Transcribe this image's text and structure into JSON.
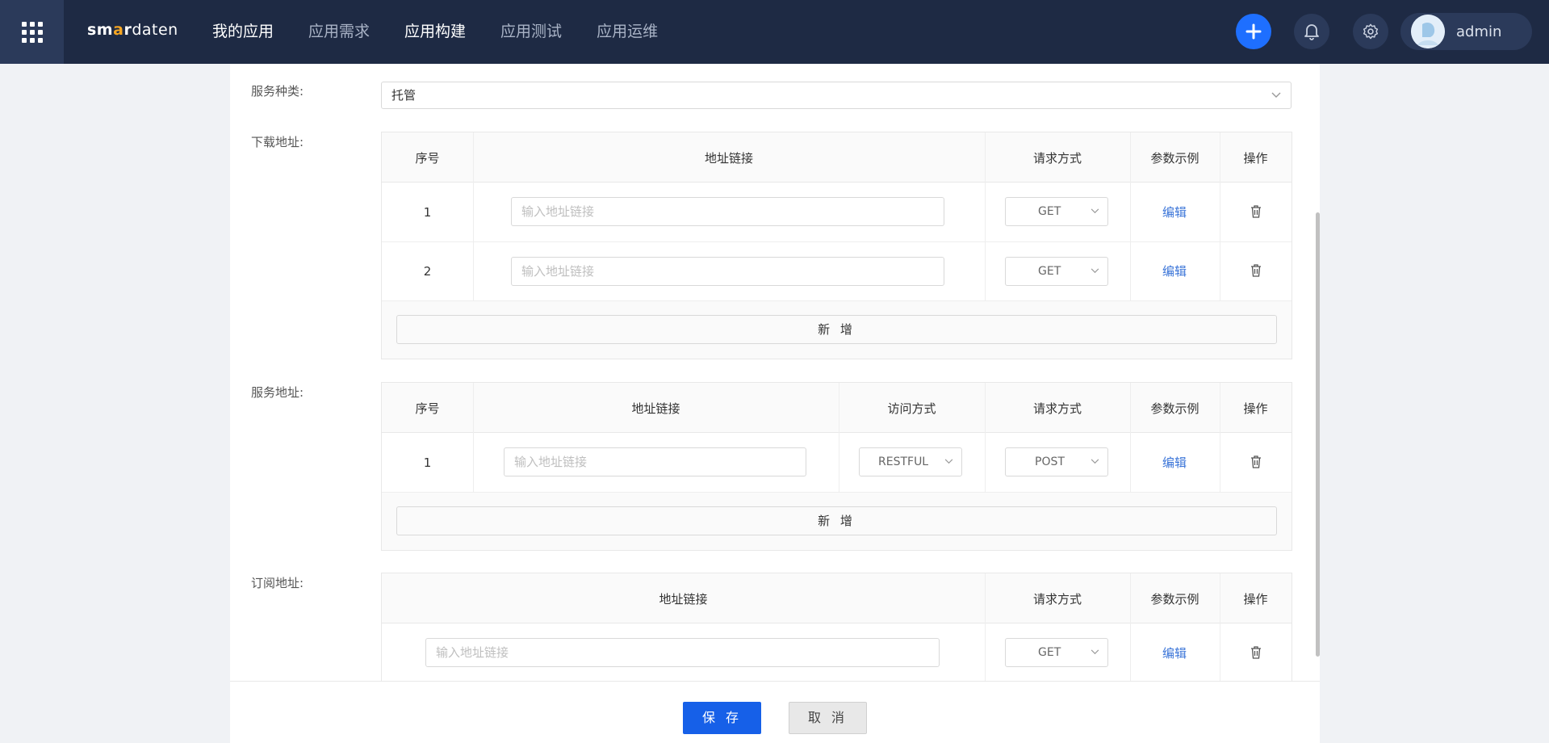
{
  "topbar": {
    "logo": {
      "p1": "sm",
      "p2": "a",
      "p3": "r",
      "p4": "daten"
    },
    "nav": [
      "我的应用",
      "应用需求",
      "应用构建",
      "应用测试",
      "应用运维"
    ],
    "user_name": "admin",
    "icons": {
      "menu": "app-grid-icon",
      "add": "plus-icon",
      "notify": "bell-icon",
      "settings": "gear-icon"
    }
  },
  "form": {
    "service_type_label": "服务种类:",
    "service_type_value": "托管",
    "download": {
      "label": "下载地址:",
      "headers": [
        "序号",
        "地址链接",
        "请求方式",
        "参数示例",
        "操作"
      ],
      "rows": [
        {
          "index": "1",
          "placeholder": "输入地址链接",
          "method": "GET",
          "edit": "编辑"
        },
        {
          "index": "2",
          "placeholder": "输入地址链接",
          "method": "GET",
          "edit": "编辑"
        }
      ],
      "add_label": "新 增"
    },
    "service": {
      "label": "服务地址:",
      "headers": [
        "序号",
        "地址链接",
        "访问方式",
        "请求方式",
        "参数示例",
        "操作"
      ],
      "rows": [
        {
          "index": "1",
          "placeholder": "输入地址链接",
          "access": "RESTFUL",
          "method": "POST",
          "edit": "编辑"
        }
      ],
      "add_label": "新 增"
    },
    "subscribe": {
      "label": "订阅地址:",
      "headers": [
        "地址链接",
        "请求方式",
        "参数示例",
        "操作"
      ],
      "rows": [
        {
          "placeholder": "输入地址链接",
          "method": "GET",
          "edit": "编辑"
        }
      ]
    }
  },
  "footer": {
    "save": "保 存",
    "cancel": "取 消"
  },
  "colors": {
    "topbar": "#1e2a44",
    "primary": "#1660e8",
    "link": "#3a74d8"
  }
}
